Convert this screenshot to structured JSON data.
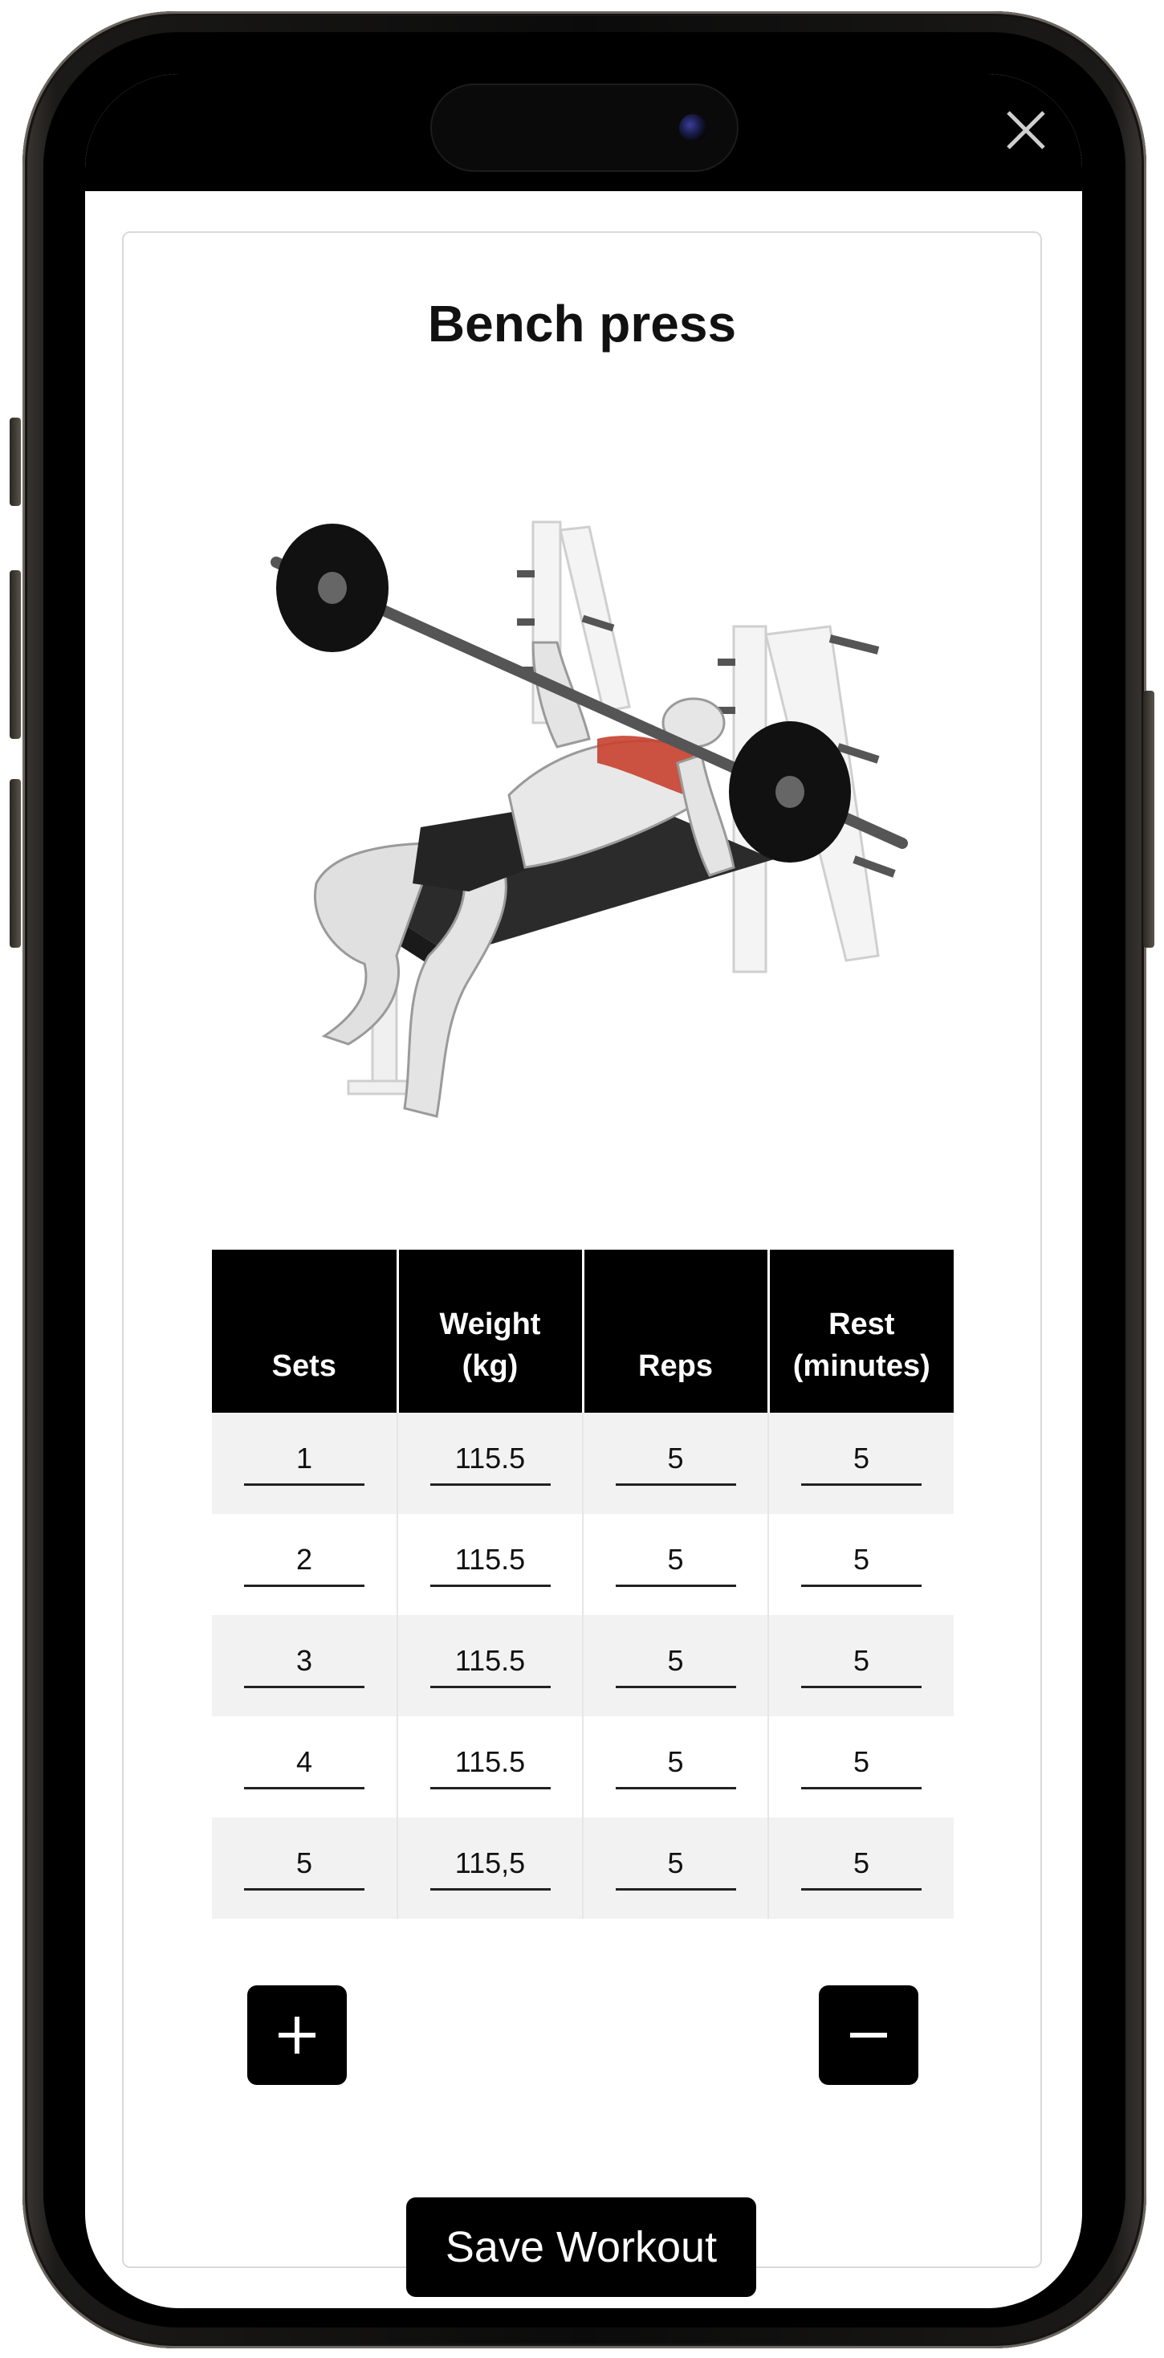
{
  "exercise": {
    "title": "Bench press",
    "illustration_icon": "bench-press-illustration"
  },
  "table": {
    "headers": [
      "Sets",
      "Weight\n(kg)",
      "Reps",
      "Rest\n(minutes)"
    ],
    "rows": [
      {
        "set": "1",
        "weight": "115.5",
        "reps": "5",
        "rest": "5"
      },
      {
        "set": "2",
        "weight": "115.5",
        "reps": "5",
        "rest": "5"
      },
      {
        "set": "3",
        "weight": "115.5",
        "reps": "5",
        "rest": "5"
      },
      {
        "set": "4",
        "weight": "115.5",
        "reps": "5",
        "rest": "5"
      },
      {
        "set": "5",
        "weight": "115,5",
        "reps": "5",
        "rest": "5"
      }
    ]
  },
  "actions": {
    "add_icon": "plus-icon",
    "remove_icon": "minus-icon",
    "save_label": "Save Workout",
    "close_icon": "close-icon"
  },
  "colors": {
    "accent": "#000000",
    "muscle_highlight": "#c8402f",
    "row_alt": "#f2f2f2"
  }
}
